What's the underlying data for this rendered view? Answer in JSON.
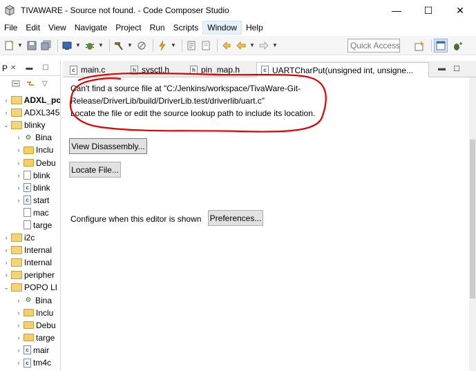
{
  "window": {
    "title": "TIVAWARE - Source not found. - Code Composer Studio",
    "minimize": "—",
    "maximize": "☐",
    "close": "✕"
  },
  "menu": [
    "File",
    "Edit",
    "View",
    "Navigate",
    "Project",
    "Run",
    "Scripts",
    "Window",
    "Help"
  ],
  "toolbar": {
    "quick_access_placeholder": "Quick Access"
  },
  "explorer": {
    "tab_label": "P",
    "tree": [
      {
        "label": "ADXL_pc",
        "kind": "project",
        "expanded": false,
        "bold": true,
        "indent": 0
      },
      {
        "label": "ADXL345",
        "kind": "project",
        "expanded": false,
        "bold": false,
        "indent": 0
      },
      {
        "label": "blinky",
        "kind": "project",
        "expanded": true,
        "bold": false,
        "indent": 0
      },
      {
        "label": "Bina",
        "kind": "binary",
        "expanded": false,
        "bold": false,
        "indent": 1
      },
      {
        "label": "Inclu",
        "kind": "folder",
        "expanded": false,
        "bold": false,
        "indent": 1
      },
      {
        "label": "Debu",
        "kind": "folder",
        "expanded": false,
        "bold": false,
        "indent": 1
      },
      {
        "label": "blink",
        "kind": "file",
        "expanded": false,
        "bold": false,
        "indent": 1
      },
      {
        "label": "blink",
        "kind": "cfile",
        "expanded": false,
        "bold": false,
        "indent": 1
      },
      {
        "label": "start",
        "kind": "cfile",
        "expanded": false,
        "bold": false,
        "indent": 1
      },
      {
        "label": "mac",
        "kind": "file",
        "expanded": null,
        "bold": false,
        "indent": 1
      },
      {
        "label": "targe",
        "kind": "file",
        "expanded": null,
        "bold": false,
        "indent": 1
      },
      {
        "label": "i2c",
        "kind": "project",
        "expanded": false,
        "bold": false,
        "indent": 0
      },
      {
        "label": "Internal",
        "kind": "project",
        "expanded": false,
        "bold": false,
        "indent": 0
      },
      {
        "label": "Internal",
        "kind": "project",
        "expanded": false,
        "bold": false,
        "indent": 0
      },
      {
        "label": "peripher",
        "kind": "project",
        "expanded": false,
        "bold": false,
        "indent": 0
      },
      {
        "label": "POPO LI",
        "kind": "project",
        "expanded": true,
        "bold": false,
        "indent": 0
      },
      {
        "label": "Bina",
        "kind": "binary",
        "expanded": false,
        "bold": false,
        "indent": 1
      },
      {
        "label": "Inclu",
        "kind": "folder",
        "expanded": false,
        "bold": false,
        "indent": 1
      },
      {
        "label": "Debu",
        "kind": "folder",
        "expanded": false,
        "bold": false,
        "indent": 1
      },
      {
        "label": "targe",
        "kind": "folder",
        "expanded": false,
        "bold": false,
        "indent": 1
      },
      {
        "label": "mair",
        "kind": "cfile",
        "expanded": false,
        "bold": false,
        "indent": 1
      },
      {
        "label": "tm4c",
        "kind": "cfile",
        "expanded": false,
        "bold": false,
        "indent": 1
      }
    ]
  },
  "editor": {
    "tabs": [
      {
        "label": "main.c",
        "active": false
      },
      {
        "label": "sysctl.h",
        "active": false
      },
      {
        "label": "pin_map.h",
        "active": false
      },
      {
        "label": "UARTCharPut(unsigned int, unsigne...",
        "active": true
      }
    ],
    "message_lines": [
      "Can't find a source file at \"C:/Jenkins/workspace/TivaWare-Git-",
      "Release/DriverLib/build/DriverLib.test/driverlib/uart.c\"",
      "Locate the file or edit the source lookup path to include its location."
    ],
    "view_disassembly_label": "View Disassembly...",
    "locate_file_label": "Locate File...",
    "configure_label": "Configure when this editor is shown",
    "preferences_label": "Preferences..."
  },
  "colors": {
    "annotation": "#e00000",
    "menu_active": "#e5f1fb"
  }
}
